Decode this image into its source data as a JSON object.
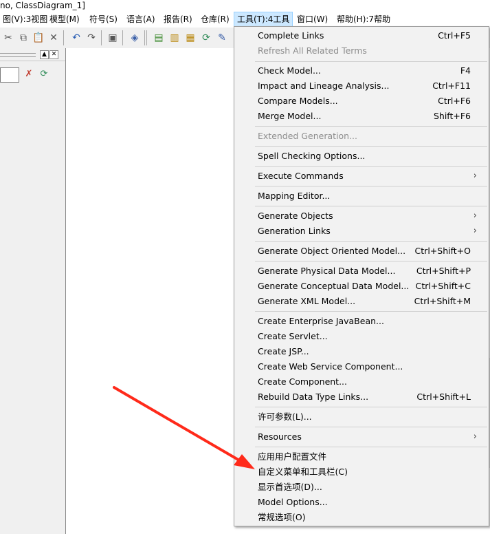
{
  "window": {
    "title": "no, ClassDiagram_1]"
  },
  "menubar": {
    "items": [
      {
        "label": "图(V):3视图"
      },
      {
        "label": "模型(M)"
      },
      {
        "label": "符号(S)"
      },
      {
        "label": "语言(A)"
      },
      {
        "label": "报告(R)"
      },
      {
        "label": "仓库(R)"
      },
      {
        "label": "工具(T):4工具"
      },
      {
        "label": "窗口(W)"
      },
      {
        "label": "帮助(H):7帮助"
      }
    ]
  },
  "toolbar": {
    "icons": [
      "cut-icon",
      "copy-icon",
      "paste-icon",
      "delete-icon",
      "undo-icon",
      "redo-icon",
      "properties-icon",
      "check-model-icon",
      "folder-icon",
      "package-icon",
      "package-add-icon",
      "refresh-icon",
      "edit-icon"
    ]
  },
  "browser": {
    "tiny_buttons": [
      "▲",
      "✕"
    ],
    "icons": [
      "filter-icon",
      "refresh-icon"
    ]
  },
  "tools_menu": {
    "items": [
      {
        "label": "Complete Links",
        "shortcut": "Ctrl+F5",
        "disabled": false,
        "submenu": false
      },
      {
        "label": "Refresh All Related Terms",
        "shortcut": "",
        "disabled": true,
        "submenu": false
      },
      {
        "label": "Check Model...",
        "shortcut": "F4",
        "disabled": false,
        "submenu": false
      },
      {
        "label": "Impact and Lineage Analysis...",
        "shortcut": "Ctrl+F11",
        "disabled": false,
        "submenu": false
      },
      {
        "label": "Compare Models...",
        "shortcut": "Ctrl+F6",
        "disabled": false,
        "submenu": false
      },
      {
        "label": "Merge Model...",
        "shortcut": "Shift+F6",
        "disabled": false,
        "submenu": false
      },
      {
        "label": "Extended Generation...",
        "shortcut": "",
        "disabled": true,
        "submenu": false
      },
      {
        "label": "Spell Checking Options...",
        "shortcut": "",
        "disabled": false,
        "submenu": false
      },
      {
        "label": "Execute Commands",
        "shortcut": "",
        "disabled": false,
        "submenu": true
      },
      {
        "label": "Mapping Editor...",
        "shortcut": "",
        "disabled": false,
        "submenu": false
      },
      {
        "label": "Generate Objects",
        "shortcut": "",
        "disabled": false,
        "submenu": true
      },
      {
        "label": "Generation Links",
        "shortcut": "",
        "disabled": false,
        "submenu": true
      },
      {
        "label": "Generate Object Oriented Model...",
        "shortcut": "Ctrl+Shift+O",
        "disabled": false,
        "submenu": false
      },
      {
        "label": "Generate Physical Data Model...",
        "shortcut": "Ctrl+Shift+P",
        "disabled": false,
        "submenu": false
      },
      {
        "label": "Generate Conceptual Data Model...",
        "shortcut": "Ctrl+Shift+C",
        "disabled": false,
        "submenu": false
      },
      {
        "label": "Generate XML Model...",
        "shortcut": "Ctrl+Shift+M",
        "disabled": false,
        "submenu": false
      },
      {
        "label": "Create Enterprise JavaBean...",
        "shortcut": "",
        "disabled": false,
        "submenu": false
      },
      {
        "label": "Create Servlet...",
        "shortcut": "",
        "disabled": false,
        "submenu": false
      },
      {
        "label": "Create JSP...",
        "shortcut": "",
        "disabled": false,
        "submenu": false
      },
      {
        "label": "Create Web Service Component...",
        "shortcut": "",
        "disabled": false,
        "submenu": false
      },
      {
        "label": "Create Component...",
        "shortcut": "",
        "disabled": false,
        "submenu": false
      },
      {
        "label": "Rebuild Data Type Links...",
        "shortcut": "Ctrl+Shift+L",
        "disabled": false,
        "submenu": false
      },
      {
        "label": "许可参数(L)...",
        "shortcut": "",
        "disabled": false,
        "submenu": false
      },
      {
        "label": "Resources",
        "shortcut": "",
        "disabled": false,
        "submenu": true
      },
      {
        "label": "应用用户配置文件",
        "shortcut": "",
        "disabled": false,
        "submenu": false
      },
      {
        "label": "自定义菜单和工具栏(C)",
        "shortcut": "",
        "disabled": false,
        "submenu": false
      },
      {
        "label": "显示首选项(D)...",
        "shortcut": "",
        "disabled": false,
        "submenu": false
      },
      {
        "label": "Model Options...",
        "shortcut": "",
        "disabled": false,
        "submenu": false
      },
      {
        "label": "常规选项(O)",
        "shortcut": "",
        "disabled": false,
        "submenu": false
      }
    ]
  },
  "colors": {
    "menu_bg": "#f2f2f2",
    "active_menu_bg": "#cce8ff",
    "annotation_arrow": "#ff2a1a"
  }
}
